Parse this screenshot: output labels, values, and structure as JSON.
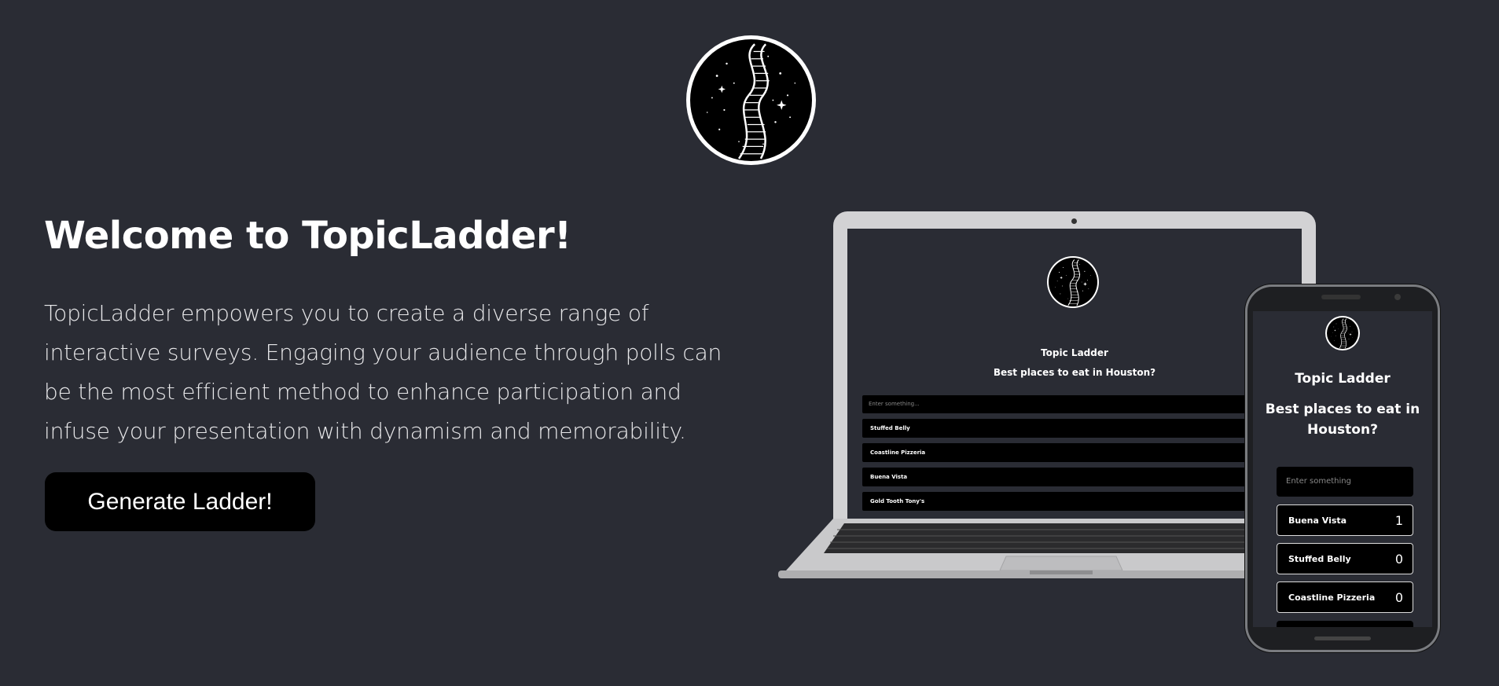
{
  "hero": {
    "title": "Welcome to TopicLadder!",
    "description": "TopicLadder empowers you to create a diverse range of interactive surveys. Engaging your audience through polls can be the most efficient method to enhance participation and infuse your presentation with dynamism and memorability.",
    "cta_label": "Generate Ladder!"
  },
  "logo": {
    "icon": "starry-staircase-logo"
  },
  "laptop_preview": {
    "app_title": "Topic Ladder",
    "question": "Best places to eat in Houston?",
    "input_placeholder": "Enter something...",
    "items": [
      "Stuffed Belly",
      "Coastline Pizzeria",
      "Buena Vista",
      "Gold Tooth Tony's"
    ]
  },
  "phone_preview": {
    "app_title": "Topic Ladder",
    "question": "Best places to eat in Houston?",
    "input_placeholder": "Enter something",
    "items": [
      {
        "label": "Buena Vista",
        "count": "1"
      },
      {
        "label": "Stuffed Belly",
        "count": "0"
      },
      {
        "label": "Coastline Pizzeria",
        "count": "0"
      }
    ]
  },
  "colors": {
    "background": "#2a2c34",
    "button": "#000000",
    "text": "#ffffff"
  }
}
